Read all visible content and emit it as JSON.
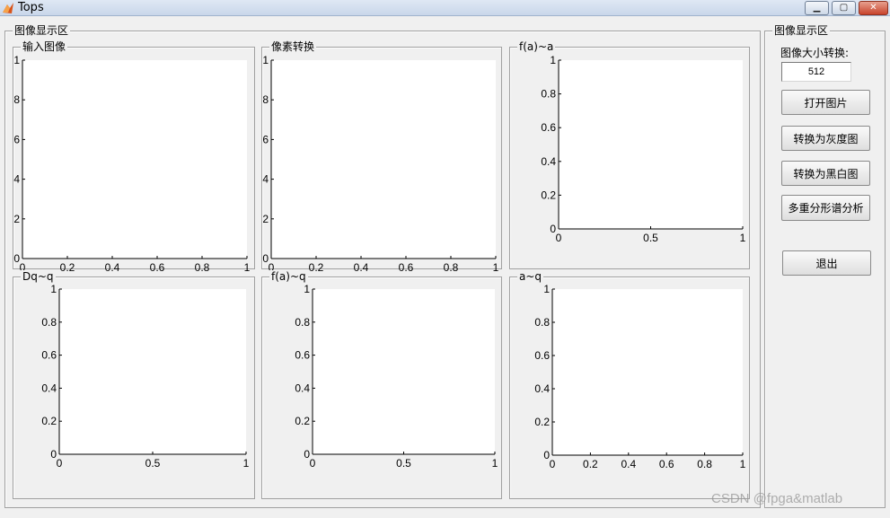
{
  "window": {
    "title": "Tops",
    "icon": "matlab-icon",
    "minimize_icon": "minimize-icon",
    "maximize_icon": "maximize-icon",
    "close_icon": "close-icon"
  },
  "display_panel": {
    "title": "图像显示区",
    "axes": [
      {
        "title": "输入图像",
        "x_ticks": [
          "0",
          "0.2",
          "0.4",
          "0.6",
          "0.8",
          "1"
        ],
        "y_ticks": [
          "0",
          "2",
          "4",
          "6",
          "8",
          "1"
        ]
      },
      {
        "title": "像素转换",
        "x_ticks": [
          "0",
          "0.2",
          "0.4",
          "0.6",
          "0.8",
          "1"
        ],
        "y_ticks": [
          "0",
          "2",
          "4",
          "6",
          "8",
          "1"
        ]
      },
      {
        "title": "f(a)~a",
        "x_ticks": [
          "0",
          "0.5",
          "1"
        ],
        "y_ticks": [
          "0",
          "0.2",
          "0.4",
          "0.6",
          "0.8",
          "1"
        ]
      },
      {
        "title": "Dq~q",
        "x_ticks": [
          "0",
          "0.5",
          "1"
        ],
        "y_ticks": [
          "0",
          "0.2",
          "0.4",
          "0.6",
          "0.8",
          "1"
        ]
      },
      {
        "title": "f(a)~q",
        "x_ticks": [
          "0",
          "0.5",
          "1"
        ],
        "y_ticks": [
          "0",
          "0.2",
          "0.4",
          "0.6",
          "0.8",
          "1"
        ]
      },
      {
        "title": "a~q",
        "x_ticks": [
          "0",
          "0.2",
          "0.4",
          "0.6",
          "0.8",
          "1"
        ],
        "y_ticks": [
          "0",
          "0.2",
          "0.4",
          "0.6",
          "0.8",
          "1"
        ]
      }
    ]
  },
  "control_panel": {
    "title": "图像显示区",
    "size_label": "图像大小转换:",
    "size_value": "512",
    "buttons": {
      "open": "打开图片",
      "gray": "转换为灰度图",
      "binary": "转换为黑白图",
      "analysis": "多重分形谱分析",
      "exit": "退出"
    }
  },
  "watermark": "CSDN @fpga&matlab"
}
